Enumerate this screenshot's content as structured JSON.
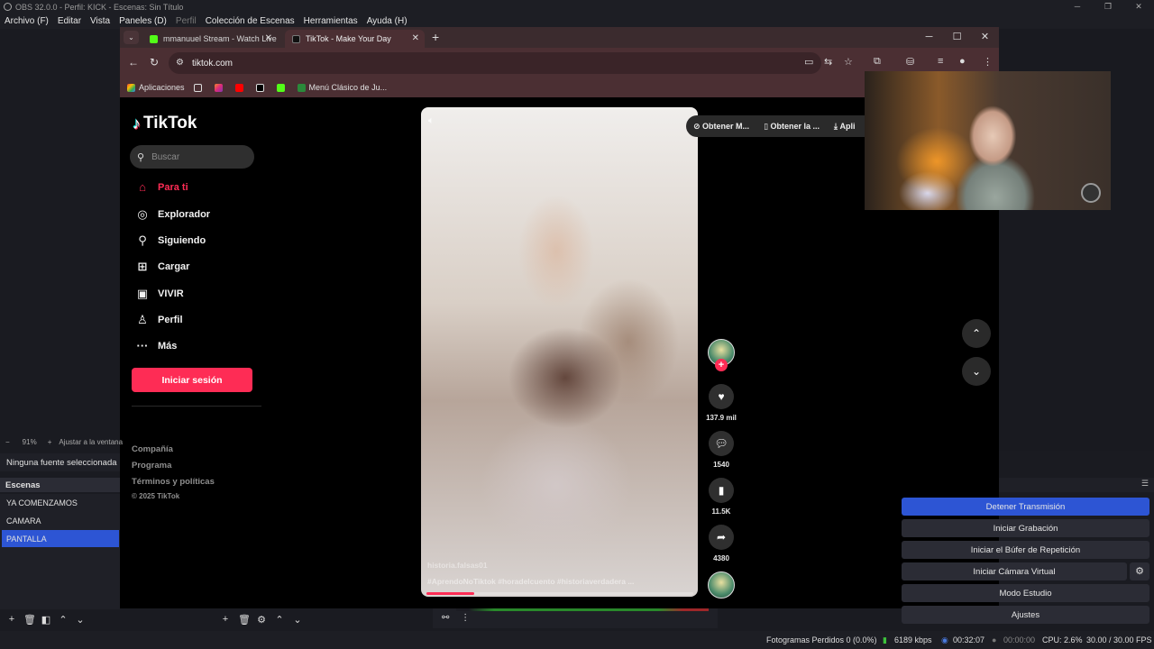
{
  "obs": {
    "window_title": "OBS 32.0.0 - Perfil: KICK - Escenas: Sin Título",
    "menu": [
      "Archivo (F)",
      "Editar",
      "Vista",
      "Paneles (D)",
      "Perfil",
      "Colección de Escenas",
      "Herramientas",
      "Ayuda (H)"
    ],
    "preview": {
      "zoom": "91%",
      "fit_label": "Ajustar a la ventana"
    },
    "no_source": "Ninguna fuente seleccionada",
    "scenes_header": "Escenas",
    "scenes": [
      "YA COMENZAMOS",
      "CAMARA",
      "PANTALLA"
    ],
    "selected_scene": "PANTALLA",
    "controls": [
      "Detener Transmisión",
      "Iniciar Grabación",
      "Iniciar el Búfer de Repetición",
      "Iniciar Cámara Virtual",
      "Modo Estudio",
      "Ajustes"
    ],
    "status": {
      "dropped_frames": "Fotogramas Perdidos 0 (0.0%)",
      "bitrate": "6189 kbps",
      "stream_time": "00:32:07",
      "rec_time": "00:00:00",
      "cpu": "CPU: 2.6%",
      "fps": "30.00 / 30.00 FPS"
    }
  },
  "browser": {
    "tabs": [
      {
        "label": "mmanuuel Stream - Watch Live",
        "favicon_color": "#53fc18"
      },
      {
        "label": "TikTok - Make Your Day",
        "favicon_color": "#000000"
      }
    ],
    "url": "tiktok.com",
    "bookmarks": [
      "Aplicaciones",
      "Menú Clásico de Ju..."
    ]
  },
  "tiktok": {
    "logo": "TikTok",
    "search_placeholder": "Buscar",
    "nav": [
      {
        "label": "Para ti",
        "icon": "home-icon",
        "glyph": "⌂"
      },
      {
        "label": "Explorador",
        "icon": "compass-icon",
        "glyph": "◎"
      },
      {
        "label": "Siguiendo",
        "icon": "user-plus-icon",
        "glyph": "⚲"
      },
      {
        "label": "Cargar",
        "icon": "upload-icon",
        "glyph": "⊞"
      },
      {
        "label": "VIVIR",
        "icon": "live-tv-icon",
        "glyph": "▣"
      },
      {
        "label": "Perfil",
        "icon": "profile-icon",
        "glyph": "♙"
      },
      {
        "label": "Más",
        "icon": "more-icon",
        "glyph": "···"
      }
    ],
    "login": "Iniciar sesión",
    "footer": [
      "Compañía",
      "Programa",
      "Términos y políticas"
    ],
    "copyright": "© 2025 TikTok",
    "actions": [
      "Obtener M...",
      "Obtener la ...",
      "Apli"
    ],
    "video": {
      "username": "historia.falsas01",
      "caption": "#AprendoNoTiktok  #horadelcuento  #historiaverdadera  ...",
      "progress": 0.18
    },
    "counts": {
      "likes": "137.9 mil",
      "comments": "1540",
      "saves": "11.5K",
      "shares": "4380"
    }
  },
  "colors": {
    "tiktok_red": "#fe2c55",
    "obs_blue": "#2d55d4",
    "chrome_frame": "#4b2f33"
  }
}
